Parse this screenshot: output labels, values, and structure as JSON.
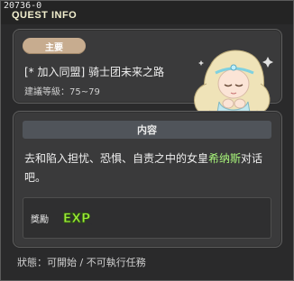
{
  "window": {
    "quest_id": "20736-0",
    "title": "QUEST INFO"
  },
  "quest": {
    "badge": "主要",
    "name": "[* 加入同盟] 骑士团未来之路",
    "level_label": "建議等級：",
    "level_value": "75~79"
  },
  "detail": {
    "header": "内容",
    "description_before": "去和陷入担忧、恐惧、自责之中的女皇",
    "description_highlight": "希纳斯",
    "description_after": "对话吧。",
    "reward_label": "獎勵",
    "reward_exp": "EXP"
  },
  "status": {
    "label": "狀態：",
    "value": "可開始 / 不可執行任務"
  },
  "colors": {
    "highlight": "#a8f57a",
    "badge_bg": "#c7ac8f",
    "exp_green": "#9ee83a"
  },
  "icons": {
    "portrait": "cygnus-portrait",
    "reward": "exp-icon"
  }
}
